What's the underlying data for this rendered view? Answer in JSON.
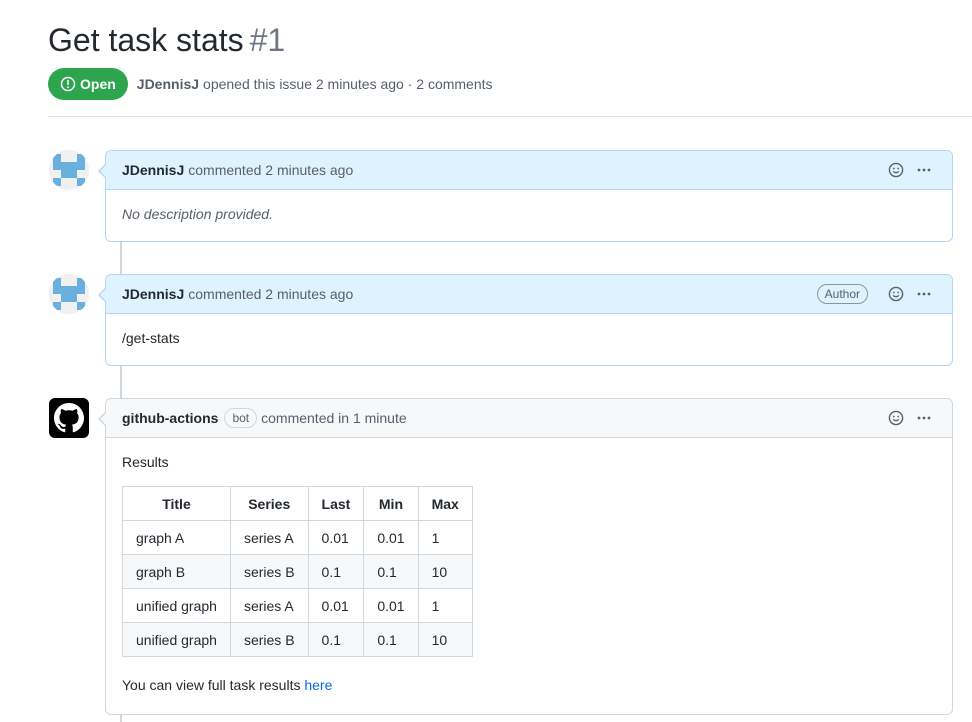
{
  "issue": {
    "title": "Get task stats",
    "number": "#1",
    "state": "Open",
    "author": "JDennisJ",
    "meta_text": "opened this issue 2 minutes ago · 2 comments"
  },
  "comments": [
    {
      "author": "JDennisJ",
      "action": "commented 2 minutes ago",
      "badge": "",
      "body": "No description provided."
    },
    {
      "author": "JDennisJ",
      "action": "commented 2 minutes ago",
      "badge": "Author",
      "body": "/get-stats"
    },
    {
      "author": "github-actions",
      "bot_label": "bot",
      "action": "commented in 1 minute",
      "intro": "Results",
      "table": {
        "headers": [
          "Title",
          "Series",
          "Last",
          "Min",
          "Max"
        ],
        "rows": [
          [
            "graph A",
            "series A",
            "0.01",
            "0.01",
            "1"
          ],
          [
            "graph B",
            "series B",
            "0.1",
            "0.1",
            "10"
          ],
          [
            "unified graph",
            "series A",
            "0.01",
            "0.01",
            "1"
          ],
          [
            "unified graph",
            "series B",
            "0.1",
            "0.1",
            "10"
          ]
        ]
      },
      "footer_text": "You can view full task results",
      "footer_link": "here"
    }
  ],
  "colors": {
    "open_green": "#2da44e",
    "link_blue": "#0969da",
    "self_header_bg": "#ddf4ff",
    "self_border": "#b6d4f8"
  },
  "icons": {
    "state": "issue-opened-icon",
    "reaction": "smiley-icon",
    "menu": "kebab-horizontal-icon",
    "bot_avatar": "github-mark-icon"
  }
}
